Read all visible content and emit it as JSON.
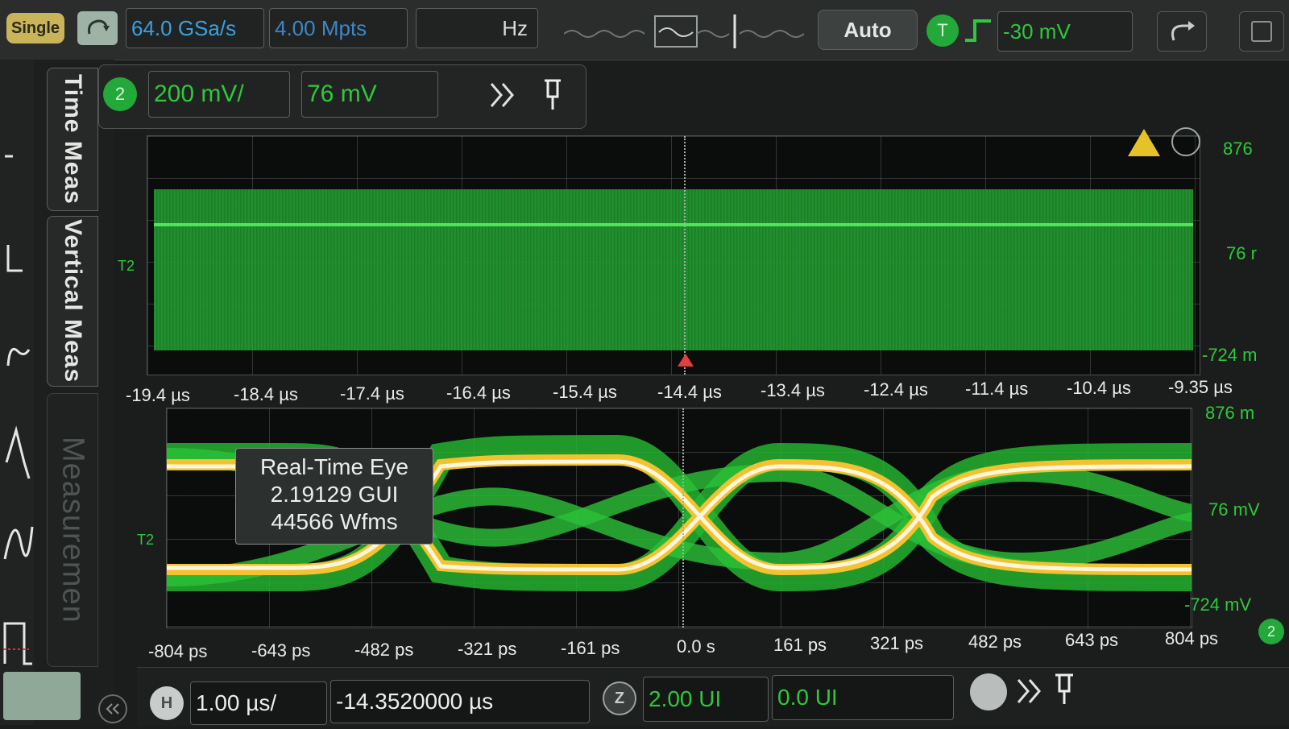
{
  "toolbar": {
    "single_label": "Single",
    "sample_rate": "64.0 GSa/s",
    "memory_depth": "4.00 Mpts",
    "bandwidth_fragment": "Hz",
    "auto_label": "Auto",
    "trigger_badge": "T",
    "trigger_level": "-30 mV"
  },
  "side_tabs": [
    "Time Meas",
    "Vertical Meas",
    "Measuremen"
  ],
  "channel": {
    "number": "2",
    "scale": "200 mV/",
    "offset": "76 mV"
  },
  "top_pane": {
    "marker": "T2",
    "x_labels": [
      "-19.4 µs",
      "-18.4 µs",
      "-17.4 µs",
      "-16.4 µs",
      "-15.4 µs",
      "-14.4 µs",
      "-13.4 µs",
      "-12.4 µs",
      "-11.4 µs",
      "-10.4 µs",
      "-9.35 µs"
    ],
    "y_labels": [
      "876",
      "76 r",
      "-724 m"
    ]
  },
  "eye_pane": {
    "marker": "T2",
    "info_lines": [
      "Real-Time Eye",
      "2.19129 GUI",
      "44566 Wfms"
    ],
    "x_labels": [
      "-804 ps",
      "-643 ps",
      "-482 ps",
      "-321 ps",
      "-161 ps",
      "0.0 s",
      "161 ps",
      "321 ps",
      "482 ps",
      "643 ps",
      "804 ps"
    ],
    "y_labels": [
      "876 m",
      "76 mV",
      "-724 mV"
    ],
    "channel_badge": "2"
  },
  "bottom": {
    "h_badge": "H",
    "timebase": "1.00 µs/",
    "position": "-14.3520000 µs",
    "z_badge": "Z",
    "ui_span": "2.00 UI",
    "ui_offset": "0.0 UI"
  },
  "colors": {
    "waveform_green": "#26a233",
    "eye_yellow": "#f2c230",
    "eye_white": "#fff6dc",
    "label_green": "#2fc83b",
    "accent_blue": "#3aa1df"
  }
}
